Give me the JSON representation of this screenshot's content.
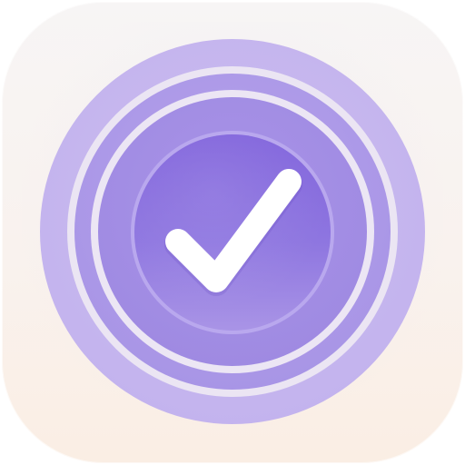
{
  "app_icon": {
    "icon": "checkmark-icon",
    "colors": {
      "accent": "#8a6fe0",
      "ring_light": "#c8b9ef",
      "ring_mid": "#b3a0ea",
      "ring_gap": "#ece6f3",
      "check": "#ffffff",
      "tile_top": "#f7f5f5",
      "tile_bottom": "#faeee4"
    }
  }
}
